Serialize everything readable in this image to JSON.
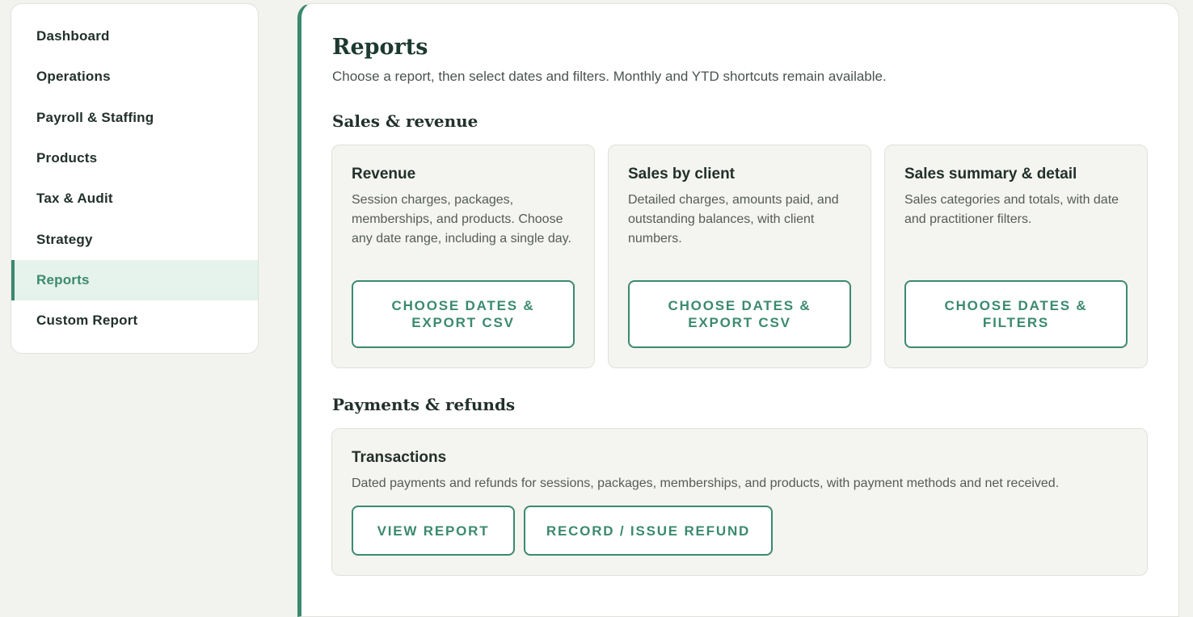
{
  "sidebar": {
    "items": [
      {
        "label": "Dashboard"
      },
      {
        "label": "Operations"
      },
      {
        "label": "Payroll & Staffing"
      },
      {
        "label": "Products"
      },
      {
        "label": "Tax & Audit"
      },
      {
        "label": "Strategy"
      },
      {
        "label": "Reports",
        "active": true
      },
      {
        "label": "Custom Report"
      }
    ]
  },
  "main": {
    "title": "Reports",
    "subtitle": "Choose a report, then select dates and filters. Monthly and YTD shortcuts remain available.",
    "sections": [
      {
        "title": "Sales & revenue",
        "cards": [
          {
            "title": "Revenue",
            "description": "Session charges, packages, memberships, and products. Choose any date range, including a single day.",
            "button": "CHOOSE DATES & EXPORT CSV"
          },
          {
            "title": "Sales by client",
            "description": "Detailed charges, amounts paid, and outstanding balances, with client numbers.",
            "button": "CHOOSE DATES & EXPORT CSV"
          },
          {
            "title": "Sales summary & detail",
            "description": "Sales categories and totals, with date and practitioner filters.",
            "button": "CHOOSE DATES & FILTERS"
          }
        ]
      },
      {
        "title": "Payments & refunds",
        "cards": [
          {
            "title": "Transactions",
            "description": "Dated payments and refunds for sessions, packages, memberships, and products, with payment methods and net received.",
            "buttons": [
              "VIEW REPORT",
              "RECORD / ISSUE REFUND"
            ]
          }
        ]
      }
    ]
  },
  "colors": {
    "accent": "#3b8a6f",
    "active_bg": "#e6f2ec",
    "page_bg": "#f2f2ee",
    "card_bg": "#f4f4f0"
  }
}
